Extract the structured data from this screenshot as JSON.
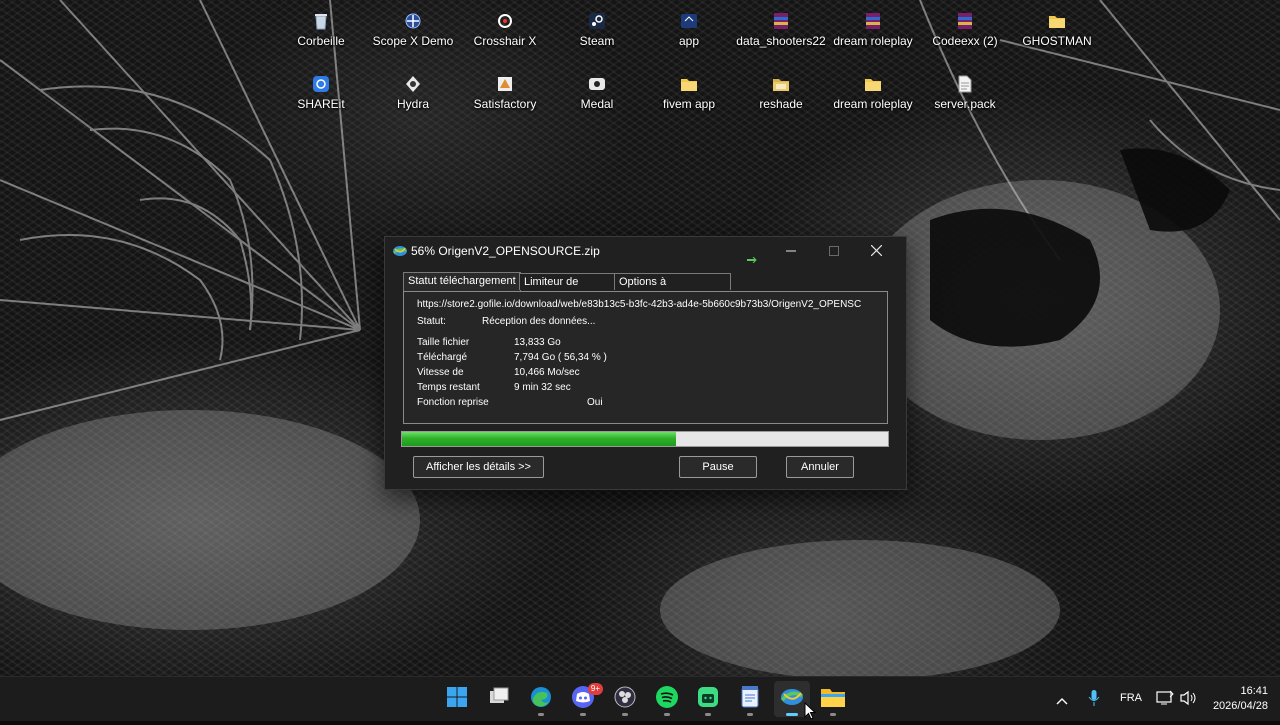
{
  "desktop": {
    "icons": [
      {
        "label": "Corbeille",
        "icon": "recycle-bin-icon"
      },
      {
        "label": "Scope X Demo",
        "icon": "scope-x-icon"
      },
      {
        "label": "Crosshair X",
        "icon": "crosshair-icon"
      },
      {
        "label": "Steam",
        "icon": "steam-icon"
      },
      {
        "label": "app",
        "icon": "app-shortcut-icon"
      },
      {
        "label": "data_shooters22",
        "icon": "winrar-archive-icon"
      },
      {
        "label": "dream roleplay",
        "icon": "winrar-archive-icon"
      },
      {
        "label": "Codeexx (2)",
        "icon": "winrar-archive-icon"
      },
      {
        "label": "GHOSTMAN",
        "icon": "folder-icon"
      },
      {
        "label": "SHAREit",
        "icon": "shareit-icon"
      },
      {
        "label": "Hydra",
        "icon": "hydra-icon"
      },
      {
        "label": "Satisfactory",
        "icon": "satisfactory-icon"
      },
      {
        "label": "Medal",
        "icon": "medal-icon"
      },
      {
        "label": "fivem app",
        "icon": "folder-icon"
      },
      {
        "label": "reshade",
        "icon": "folder-icon"
      },
      {
        "label": "dream roleplay",
        "icon": "folder-icon"
      },
      {
        "label": "server.pack",
        "icon": "file-icon"
      }
    ]
  },
  "dialog": {
    "title": "56% OrigenV2_OPENSOURCE.zip",
    "tabs": [
      "Statut téléchargement",
      "Limiteur de vitesse",
      "Options à l'achèvement"
    ],
    "url": "https://store2.gofile.io/download/web/e83b13c5-b3fc-42b3-ad4e-5b660c9b73b3/OrigenV2_OPENSC",
    "status_label": "Statut:",
    "status_value": "Réception des données...",
    "details": [
      {
        "label": "Taille fichier",
        "value": "13,833  Go"
      },
      {
        "label": "Téléchargé",
        "value": "7,794  Go  ( 56,34 % )"
      },
      {
        "label": "Vitesse de",
        "value": "10,466  Mo/sec"
      },
      {
        "label": "Temps restant",
        "value": "9 min 32 sec"
      }
    ],
    "resume_label": "Fonction reprise",
    "resume_value": "Oui",
    "progress_percent": 56.34,
    "buttons": {
      "details": "Afficher les détails >>",
      "pause": "Pause",
      "cancel": "Annuler"
    }
  },
  "taskbar": {
    "apps": [
      "windows-start-icon",
      "task-view-icon",
      "edge-icon",
      "discord-icon",
      "obs-icon",
      "spotify-icon",
      "android-studio-icon",
      "notepad-icon",
      "idm-icon",
      "file-explorer-icon"
    ],
    "discord_badge": "9+",
    "language": "FRA",
    "time": "16:41",
    "date": "2026/04/28"
  },
  "colors": {
    "progress": "#2fb12a",
    "accent": "#60cdff",
    "dialog_bg": "#202020"
  }
}
